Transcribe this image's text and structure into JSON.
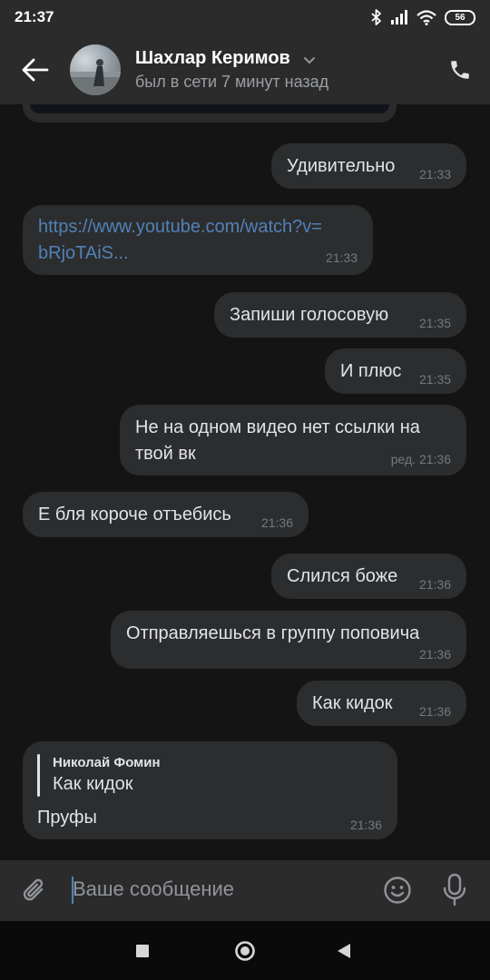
{
  "status_bar": {
    "time": "21:37",
    "battery_level": "56",
    "icons": [
      "bluetooth-icon",
      "signal-icon",
      "wifi-icon",
      "battery-icon"
    ]
  },
  "header": {
    "contact_name": "Шахлар Керимов",
    "last_seen": "был в сети 7 минут назад",
    "icons": [
      "back-arrow-icon",
      "chevron-down-icon",
      "phone-icon"
    ]
  },
  "messages": [
    {
      "direction": "out",
      "text": "Удивительно",
      "time": "21:33"
    },
    {
      "direction": "in",
      "link_line1": "https://www.youtube.com/watch?v=",
      "link_line2": "bRjoTAiS...",
      "time": "21:33"
    },
    {
      "direction": "out",
      "text": "Запиши голосовую",
      "time": "21:35"
    },
    {
      "direction": "out",
      "text": "И плюс",
      "time": "21:35"
    },
    {
      "direction": "out",
      "line1": "Не на одном видео нет ссылки на",
      "line2": "твой вк",
      "time": "ред. 21:36"
    },
    {
      "direction": "in",
      "text": "Е бля короче отъебись",
      "time": "21:36"
    },
    {
      "direction": "out",
      "text": "Слился боже",
      "time": "21:36"
    },
    {
      "direction": "out",
      "text": "Отправляешься в группу поповича",
      "time": "21:36"
    },
    {
      "direction": "out",
      "text": "Как кидок",
      "time": "21:36"
    },
    {
      "direction": "in",
      "reply_author": "Николай Фомин",
      "reply_text": "Как кидок",
      "text": "Пруфы",
      "time": "21:36"
    }
  ],
  "composer": {
    "placeholder": "Ваше сообщение",
    "icons": [
      "attach-icon",
      "emoji-icon",
      "microphone-icon"
    ]
  },
  "colors": {
    "background": "#141414",
    "bar": "#2b2b2c",
    "bubble": "#2c2d2e",
    "text": "#e1e3e6",
    "secondary_text": "#909499",
    "link": "#5181b8"
  }
}
